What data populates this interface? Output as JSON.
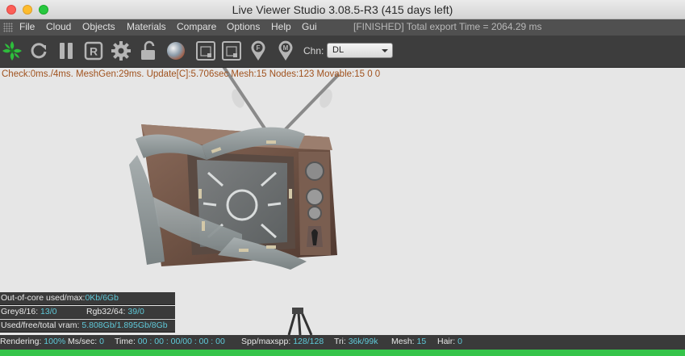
{
  "window": {
    "title": "Live Viewer Studio 3.08.5-R3 (415 days left)"
  },
  "menu": {
    "items": [
      "File",
      "Cloud",
      "Objects",
      "Materials",
      "Compare",
      "Options",
      "Help",
      "Gui"
    ],
    "status": "[FINISHED] Total export Time = 2064.29 ms"
  },
  "toolbar": {
    "icons": [
      "octane-logo-icon",
      "refresh-icon",
      "pause-icon",
      "render-r-icon",
      "gear-icon",
      "unlock-icon",
      "material-sphere-icon",
      "region-frame-icon",
      "region-frame-icon-2",
      "focus-pin-icon",
      "material-pin-icon"
    ],
    "channel_label": "Chn:",
    "channel_value": "DL"
  },
  "viewport": {
    "stats": "Check:0ms./4ms. MeshGen:29ms. Update[C]:5.706sec Mesh:15 Nodes:123 Movable:15  0 0"
  },
  "info": {
    "ooc_label": "Out-of-core used/max:",
    "ooc_value": "0Kb/6Gb",
    "grey_label": "Grey8/16:",
    "grey_value": "13/0",
    "rgb_label": "Rgb32/64:",
    "rgb_value": "39/0",
    "vram_label": "Used/free/total vram:",
    "vram_value": "5.808Gb/1.895Gb/8Gb"
  },
  "status": {
    "rendering_label": "Rendering:",
    "rendering_value": "100%",
    "mssec_label": "Ms/sec:",
    "mssec_value": "0",
    "time_label": "Time:",
    "time_value": "00 : 00 : 00/00 : 00 : 00",
    "spp_label": "Spp/maxspp:",
    "spp_value": "128/128",
    "tri_label": "Tri:",
    "tri_value": "36k/99k",
    "mesh_label": "Mesh:",
    "mesh_value": "15",
    "hair_label": "Hair:",
    "hair_value": "0",
    "progress": 1.0
  },
  "colors": {
    "stats_text": "#a0521e",
    "info_value": "#5fc9d9",
    "progress": "#35c44a"
  }
}
